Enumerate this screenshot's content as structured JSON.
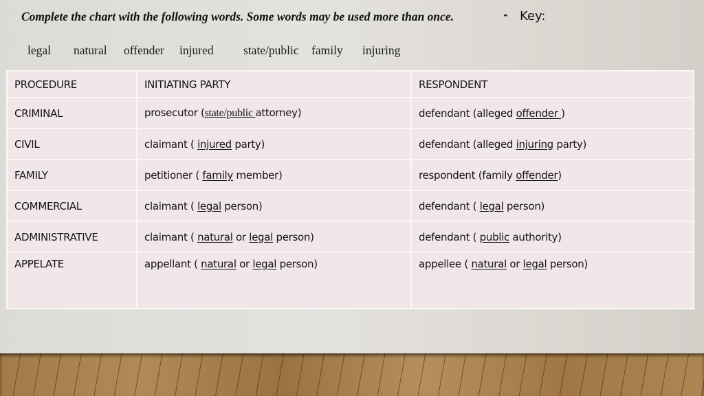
{
  "header": {
    "instructions": "Complete the chart with the following words. Some words may be used more than once.",
    "separator": "-",
    "key_label": "Key:"
  },
  "word_bank": [
    "legal",
    "natural",
    "offender",
    "injured",
    "state/public",
    "family",
    "injuring"
  ],
  "table": {
    "headers": [
      "PROCEDURE",
      "INITIATING PARTY",
      "RESPONDENT"
    ],
    "rows": [
      {
        "procedure": "CRIMINAL",
        "initiating": {
          "before": "prosecutor (",
          "blank": "state/public ",
          "after": "attorney)"
        },
        "respondent": {
          "before": "defendant (alleged ",
          "blank": "offender ",
          "after": ")"
        }
      },
      {
        "procedure": "CIVIL",
        "initiating": {
          "before": "claimant ( ",
          "blank": "injured",
          "after": " party)"
        },
        "respondent": {
          "before": "defendant (alleged ",
          "blank": "injuring",
          "after": " party)"
        }
      },
      {
        "procedure": "FAMILY",
        "initiating": {
          "before": "petitioner ( ",
          "blank": "family",
          "after": " member)"
        },
        "respondent": {
          "before": "respondent (family ",
          "blank": "offender",
          "after": ")"
        }
      },
      {
        "procedure": "COMMERCIAL",
        "initiating": {
          "before": "claimant ( ",
          "blank": "legal",
          "after": " person)"
        },
        "respondent": {
          "before": "defendant ( ",
          "blank": "legal",
          "after": " person)"
        }
      },
      {
        "procedure": "ADMINISTRATIVE",
        "initiating": {
          "before": "claimant ( ",
          "blank": "natural",
          "middle": " or ",
          "blank2": "legal",
          "after": " person)"
        },
        "respondent": {
          "before": "defendant ( ",
          "blank": "public",
          "after": " authority)"
        }
      },
      {
        "procedure": "APPELATE",
        "initiating": {
          "before": "appellant ( ",
          "blank": "natural",
          "middle": " or ",
          "blank2": "legal",
          "after": " person)"
        },
        "respondent": {
          "before": "appellee ( ",
          "blank": "natural",
          "middle": " or ",
          "blank2": "legal",
          "after": " person)"
        }
      }
    ]
  }
}
